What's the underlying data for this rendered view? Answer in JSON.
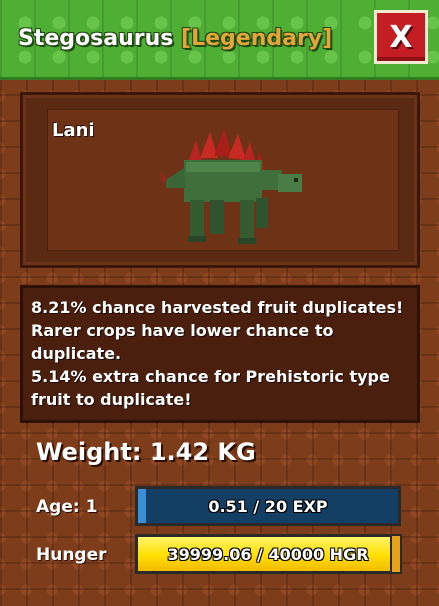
{
  "header": {
    "species": "Stegosaurus",
    "rarity": "[Legendary]",
    "rarity_color": "#e4a63b",
    "close_label": "X"
  },
  "pet": {
    "name": "Lani",
    "image_icon": "stegosaurus-model"
  },
  "description": {
    "lines": [
      "8.21% chance harvested fruit duplicates!",
      "Rarer crops have lower chance to",
      "duplicate.",
      "5.14% extra chance for Prehistoric type",
      "fruit to duplicate!"
    ]
  },
  "stats": {
    "weight_label": "Weight: 1.42 KG",
    "age_label": "Age: 1",
    "exp_text": "0.51 / 20 EXP",
    "exp_progress": 0.0255,
    "hunger_label": "Hunger",
    "hunger_text": "39999.06 / 40000 HGR",
    "hunger_progress": 0.99998
  },
  "colors": {
    "header_green": "#4fae34",
    "close_red": "#c41d24",
    "exp_blue": "#3b8fd6",
    "hunger_yellow": "#ffdf00"
  }
}
